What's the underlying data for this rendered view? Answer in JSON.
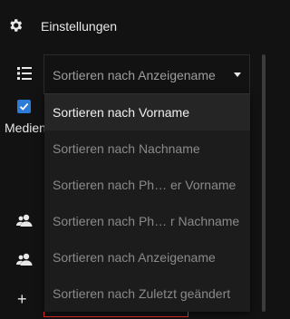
{
  "settings": {
    "label": "Einstellungen"
  },
  "media_checkbox": {
    "label": "Medien",
    "checked": true
  },
  "sort_select": {
    "value": "Sortieren nach Anzeigename",
    "options": [
      {
        "label": "Sortieren nach Vorname",
        "selected": true
      },
      {
        "label": "Sortieren nach Nachname",
        "selected": false
      },
      {
        "label": "Sortieren nach Ph…  er Vorname",
        "selected": false
      },
      {
        "label": "Sortieren nach Ph…  r Nachname",
        "selected": false
      },
      {
        "label": "Sortieren nach Anzeigename",
        "selected": false
      },
      {
        "label": "Sortieren nach Zuletzt geändert",
        "selected": false
      }
    ]
  },
  "icons": {
    "settings": "gear-icon",
    "list": "list-icon",
    "account1": "account-multiple-icon",
    "account2": "account-multiple-icon",
    "add": "plus-icon"
  },
  "colors": {
    "background": "#121212",
    "dropdown_bg": "#1c1c1c",
    "accent": "#2d7bd8",
    "error": "#c62828"
  }
}
